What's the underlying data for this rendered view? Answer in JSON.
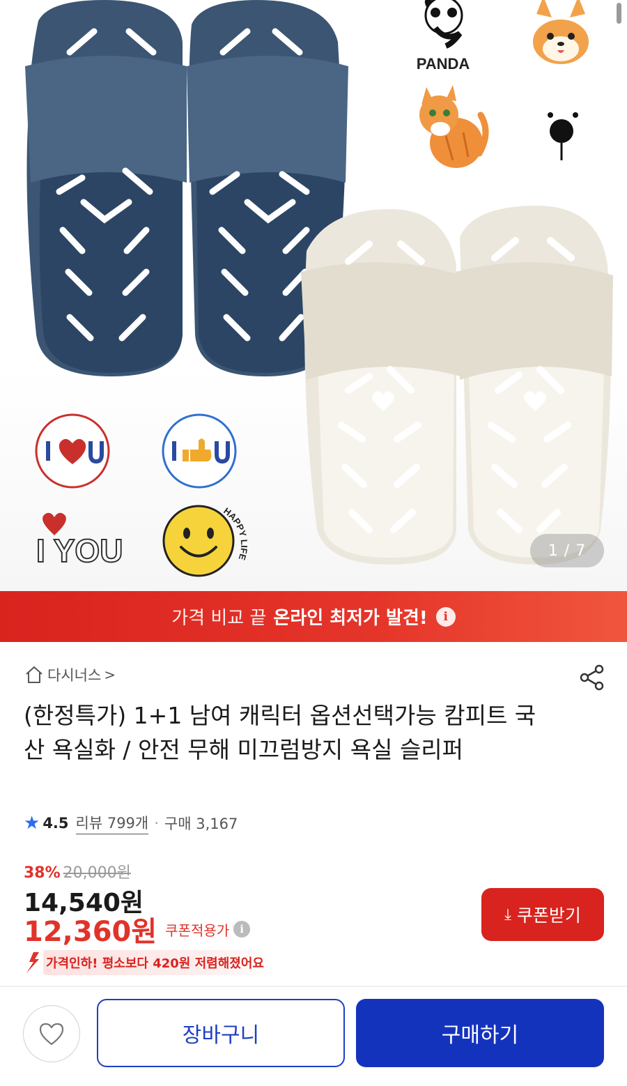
{
  "gallery": {
    "page_indicator": "1 / 7",
    "sticker_text": {
      "panda": "PANDA",
      "happy_life": "HAPPY LIFE",
      "iyou": "I YOU"
    }
  },
  "promo": {
    "prefix": "가격 비교 끝",
    "highlight": "온라인 최저가 발견!",
    "info_icon": "i"
  },
  "seller": {
    "name": "다시너스",
    "chevron": ">"
  },
  "product": {
    "title": "(한정특가) 1+1 남여 캐릭터 옵션선택가능 캄피트 국산 욕실화 / 안전 무해 미끄럼방지 욕실 슬리퍼",
    "rating": "4.5",
    "review_label": "리뷰 799개",
    "separator": "·",
    "purchase_label": "구매 3,167"
  },
  "price": {
    "discount": "38%",
    "original": "20,000원",
    "sale": "14,540원",
    "coupon_price": "12,360원",
    "coupon_label": "쿠폰적용가",
    "info_icon": "i",
    "drop_note": "가격인하! 평소보다 420원 저렴해졌어요"
  },
  "buttons": {
    "coupon": "쿠폰받기",
    "coupon_icon": "⤓",
    "cart": "장바구니",
    "buy": "구매하기"
  },
  "colors": {
    "accent_red": "#d9231e",
    "accent_blue": "#1433bd",
    "navy_slipper": "#3b5573",
    "cream_slipper": "#ece7dc",
    "rating_star": "#2c6cf0"
  },
  "icons": [
    "home-icon",
    "share-icon",
    "star-icon",
    "heart-icon",
    "download-icon",
    "info-icon",
    "price-drop-arrow-icon"
  ]
}
